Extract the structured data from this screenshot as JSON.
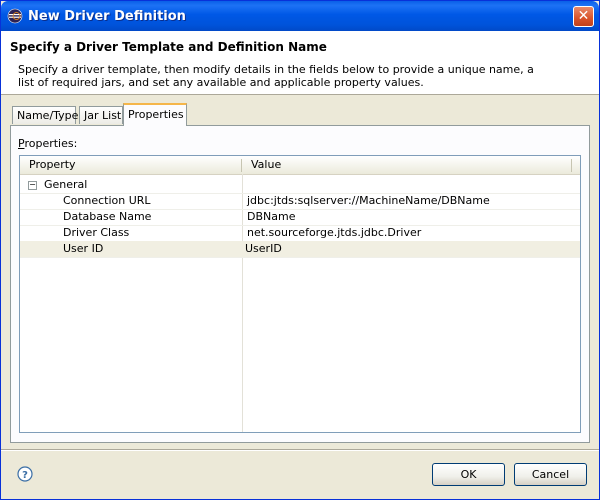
{
  "window": {
    "title": "New Driver Definition",
    "close_label": "✕"
  },
  "header": {
    "title": "Specify a Driver Template and Definition Name",
    "description": "Specify a driver template, then modify details in the fields below to provide a unique name, a list of required jars, and set any available and applicable property values."
  },
  "tabs": [
    {
      "label": "Name/Type",
      "active": false
    },
    {
      "label": "Jar List",
      "active": false
    },
    {
      "label": "Properties",
      "active": true
    }
  ],
  "properties": {
    "label_access_key": "P",
    "label_rest": "roperties:",
    "columns": [
      "Property",
      "Value"
    ],
    "group": {
      "label": "General",
      "expander": "−"
    },
    "rows": [
      {
        "property": "Connection URL",
        "value": "jdbc:jtds:sqlserver://MachineName/DBName"
      },
      {
        "property": "Database Name",
        "value": "DBName"
      },
      {
        "property": "Driver Class",
        "value": "net.sourceforge.jtds.jdbc.Driver"
      },
      {
        "property": "User ID",
        "value": "UserID",
        "selected": true
      }
    ]
  },
  "footer": {
    "help_icon": "help-icon",
    "ok_label": "OK",
    "cancel_label": "Cancel"
  }
}
